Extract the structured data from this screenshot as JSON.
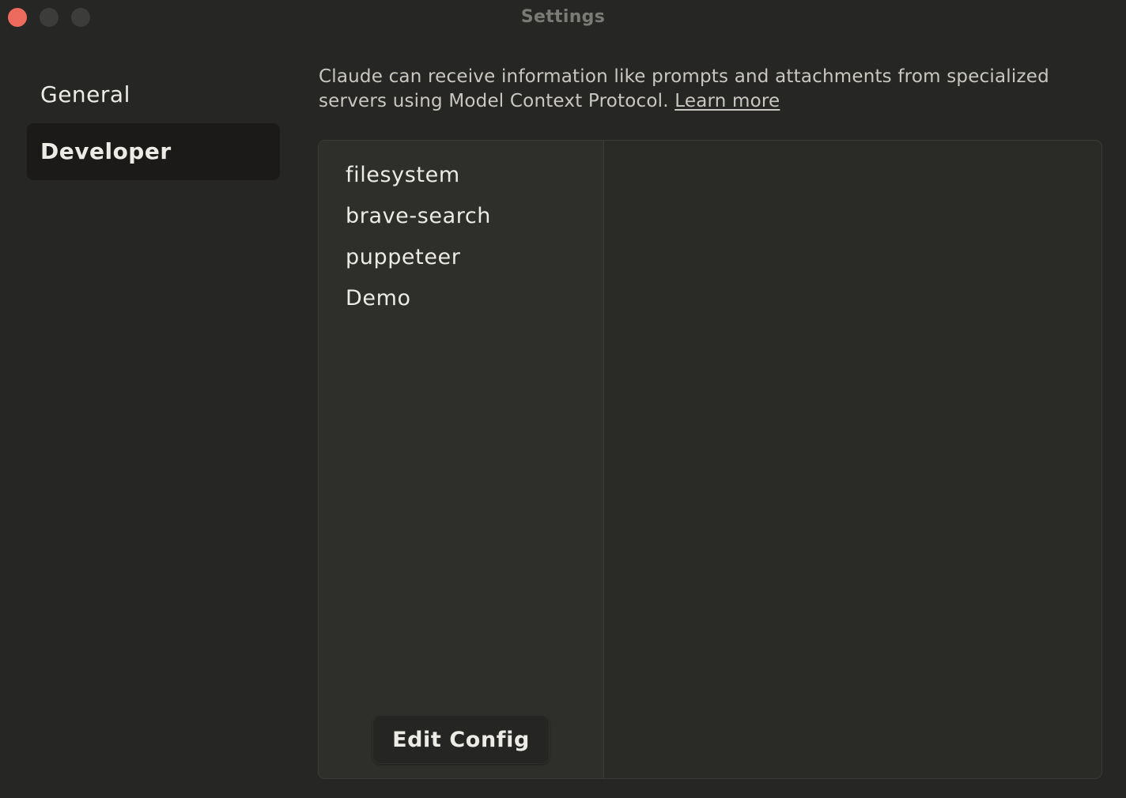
{
  "window": {
    "title": "Settings",
    "traffic_lights": {
      "close_color": "#ec6a5e",
      "minimize_color": "#3c3c3a",
      "maximize_color": "#3c3c3a"
    }
  },
  "sidebar": {
    "items": [
      {
        "label": "General",
        "active": false
      },
      {
        "label": "Developer",
        "active": true
      }
    ]
  },
  "developer": {
    "description": "Claude can receive information like prompts and attachments from specialized servers using Model Context Protocol.",
    "learn_more_label": "Learn more",
    "servers": [
      {
        "name": "filesystem"
      },
      {
        "name": "brave-search"
      },
      {
        "name": "puppeteer"
      },
      {
        "name": "Demo"
      }
    ],
    "edit_config_label": "Edit Config"
  }
}
